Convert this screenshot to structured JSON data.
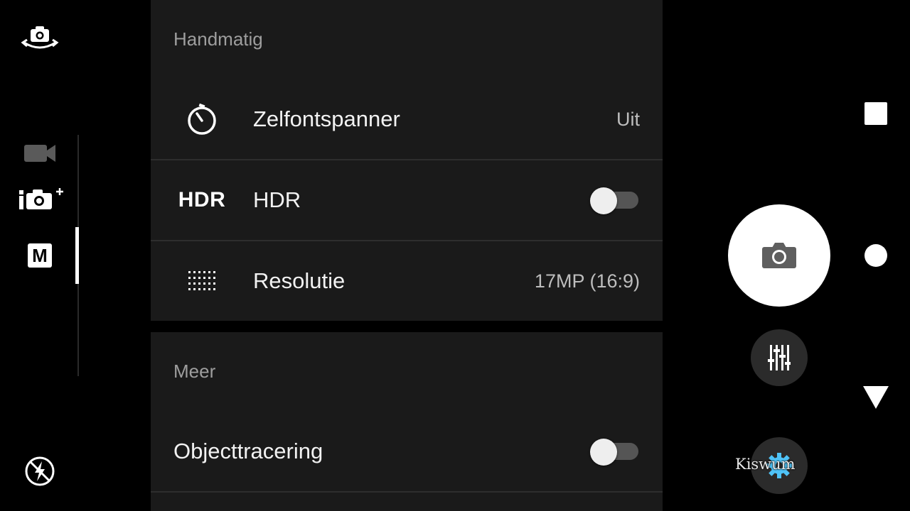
{
  "rail": {
    "switch_camera_icon": "switch-camera-icon",
    "modes": [
      {
        "name": "video",
        "icon": "video-camera-icon"
      },
      {
        "name": "superior-auto",
        "icon": "superior-auto-camera-icon"
      },
      {
        "name": "manual",
        "icon": "manual-mode-icon",
        "label": "M",
        "selected": true
      }
    ],
    "flash_icon": "flash-off-icon"
  },
  "settings": {
    "sections": [
      {
        "title": "Handmatig",
        "rows": [
          {
            "label": "Zelfontspanner",
            "value": "Uit",
            "icon": "self-timer-icon"
          },
          {
            "label": "HDR",
            "icon_text": "HDR",
            "toggle": false
          },
          {
            "label": "Resolutie",
            "value": "17MP (16:9)",
            "icon": "resolution-grid-icon"
          }
        ]
      },
      {
        "title": "Meer",
        "rows": [
          {
            "label": "Objecttracering",
            "toggle": false
          }
        ]
      }
    ]
  },
  "controls": {
    "shutter_icon": "camera-shutter-icon",
    "adjust_icon": "manual-adjust-sliders-icon",
    "settings_icon": "settings-gear-icon",
    "watermark": "Kiswum"
  },
  "nav": {
    "recents_icon": "recents-square-icon",
    "home_icon": "home-circle-icon",
    "back_icon": "back-triangle-icon"
  },
  "colors": {
    "panel": "#1a1a1a",
    "background": "#000000",
    "section_title": "#9e9e9e",
    "accent_gear": "#4fc3f7"
  }
}
